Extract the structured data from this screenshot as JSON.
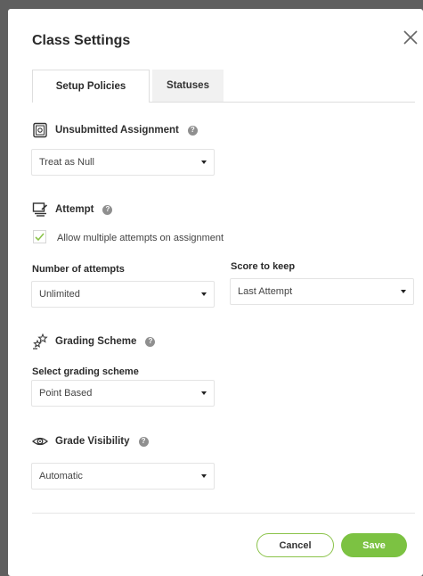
{
  "dialog": {
    "title": "Class Settings",
    "close_icon": "close-x-icon"
  },
  "tabs": [
    {
      "label": "Setup Policies",
      "active": true
    },
    {
      "label": "Statuses",
      "active": false
    }
  ],
  "sections": {
    "unsubmitted": {
      "heading": "Unsubmitted Assignment",
      "icon": "assignment-icon",
      "select_value": "Treat as Null"
    },
    "attempt": {
      "heading": "Attempt",
      "icon": "attempt-icon",
      "checkbox_label": "Allow multiple attempts on assignment",
      "checkbox_checked": true,
      "attempts_label": "Number of attempts",
      "attempts_value": "Unlimited",
      "score_label": "Score to keep",
      "score_value": "Last Attempt"
    },
    "grading": {
      "heading": "Grading Scheme",
      "icon": "grading-stars-icon",
      "select_label": "Select grading scheme",
      "select_value": "Point Based"
    },
    "visibility": {
      "heading": "Grade Visibility",
      "icon": "eye-icon",
      "select_value": "Automatic"
    }
  },
  "help_glyph": "?",
  "footer": {
    "cancel_label": "Cancel",
    "save_label": "Save"
  },
  "colors": {
    "accent_green": "#7cc242",
    "overlay": "#5f5f5f"
  }
}
